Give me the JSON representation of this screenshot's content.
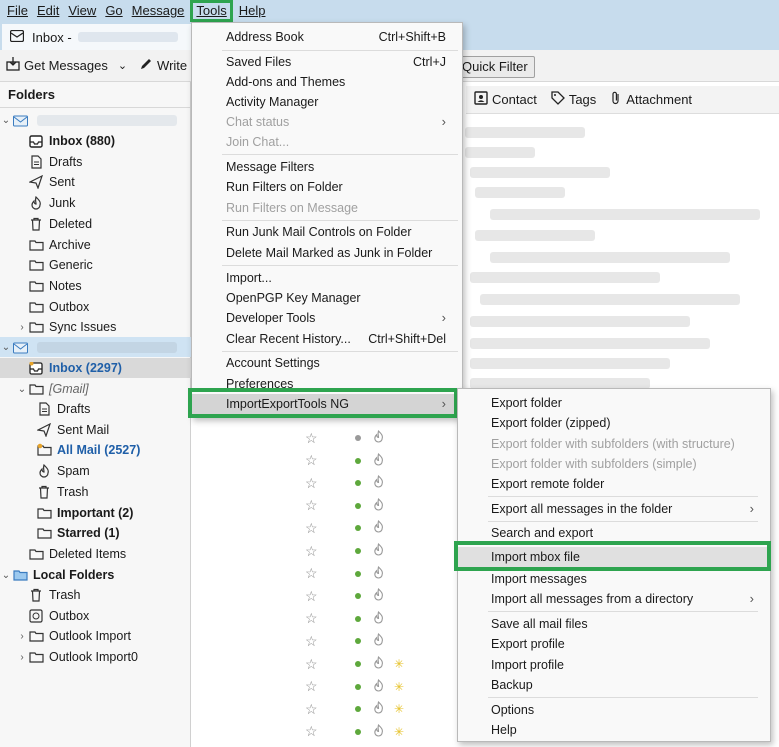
{
  "menubar": {
    "items": [
      "File",
      "Edit",
      "View",
      "Go",
      "Message",
      "Tools",
      "Help"
    ]
  },
  "tab": {
    "title": "Inbox -"
  },
  "toolbar": {
    "get_messages": "Get Messages",
    "write": "Write",
    "quick_filter": "Quick Filter"
  },
  "filterbar": {
    "contact": "Contact",
    "tags": "Tags",
    "attachment": "Attachment"
  },
  "folders": {
    "header": "Folders",
    "account1": [
      {
        "label": "Inbox (880)",
        "icon": "inbox-icon"
      },
      {
        "label": "Drafts",
        "icon": "drafts-icon"
      },
      {
        "label": "Sent",
        "icon": "sent-icon"
      },
      {
        "label": "Junk",
        "icon": "junk-icon"
      },
      {
        "label": "Deleted",
        "icon": "trash-icon"
      },
      {
        "label": "Archive",
        "icon": "folder-icon"
      },
      {
        "label": "Generic",
        "icon": "folder-icon"
      },
      {
        "label": "Notes",
        "icon": "folder-icon"
      },
      {
        "label": "Outbox",
        "icon": "folder-icon"
      },
      {
        "label": "Sync Issues",
        "icon": "folder-icon"
      }
    ],
    "account2_inbox": "Inbox (2297)",
    "gmail_label": "[Gmail]",
    "gmail": [
      {
        "label": "Drafts",
        "icon": "drafts-icon"
      },
      {
        "label": "Sent Mail",
        "icon": "sent-icon"
      },
      {
        "label": "All Mail (2527)",
        "icon": "all-mail-icon"
      },
      {
        "label": "Spam",
        "icon": "junk-icon"
      },
      {
        "label": "Trash",
        "icon": "trash-icon"
      },
      {
        "label": "Important (2)",
        "icon": "folder-icon"
      },
      {
        "label": "Starred (1)",
        "icon": "folder-icon"
      }
    ],
    "deleted_items": "Deleted Items",
    "local_folders": "Local Folders",
    "local": [
      {
        "label": "Trash",
        "icon": "trash-icon"
      },
      {
        "label": "Outbox",
        "icon": "outbox-icon"
      },
      {
        "label": "Outlook Import",
        "icon": "folder-icon"
      },
      {
        "label": "Outlook Import0",
        "icon": "folder-icon"
      }
    ]
  },
  "tools_menu": {
    "address_book": "Address Book",
    "address_book_key": "Ctrl+Shift+B",
    "saved_files": "Saved Files",
    "saved_files_key": "Ctrl+J",
    "addons": "Add-ons and Themes",
    "activity": "Activity Manager",
    "chat_status": "Chat status",
    "join_chat": "Join Chat...",
    "message_filters": "Message Filters",
    "run_filters_folder": "Run Filters on Folder",
    "run_filters_message": "Run Filters on Message",
    "run_junk": "Run Junk Mail Controls on Folder",
    "delete_junk": "Delete Mail Marked as Junk in Folder",
    "import": "Import...",
    "openpgp": "OpenPGP Key Manager",
    "devtools": "Developer Tools",
    "clear_history": "Clear Recent History...",
    "clear_history_key": "Ctrl+Shift+Del",
    "account_settings": "Account Settings",
    "preferences": "Preferences",
    "importexport": "ImportExportTools NG"
  },
  "submenu": {
    "export_folder": "Export folder",
    "export_folder_zipped": "Export folder (zipped)",
    "export_subfolders_structure": "Export folder with subfolders (with structure)",
    "export_subfolders_simple": "Export folder with subfolders (simple)",
    "export_remote": "Export remote folder",
    "export_all": "Export all messages in the folder",
    "search_export": "Search and export",
    "import_mbox": "Import mbox file",
    "import_messages": "Import messages",
    "import_all_dir": "Import all messages from a directory",
    "save_all": "Save all mail files",
    "export_profile": "Export profile",
    "import_profile": "Import profile",
    "backup": "Backup",
    "options": "Options",
    "help": "Help"
  },
  "colors": {
    "highlight_border": "#2ea44f",
    "chrome": "#c7dced",
    "link_blue": "#1f5fa8"
  }
}
